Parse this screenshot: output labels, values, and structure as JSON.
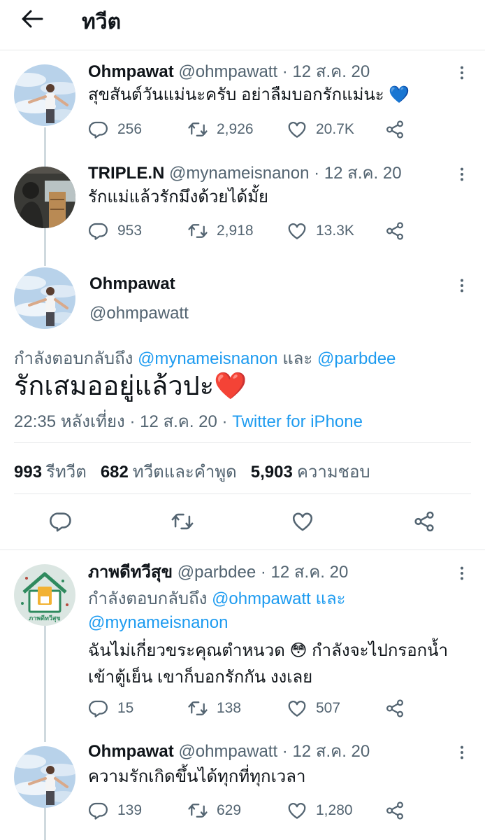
{
  "header": {
    "title": "ทวีต"
  },
  "tweets": [
    {
      "name": "Ohmpawat",
      "handle": "@ohmpawatt",
      "date": "· 12 ส.ค. 20",
      "text": "สุขสันต์วันแม่นะครับ อย่าลืมบอกรักแม่นะ 💙",
      "replies": "256",
      "retweets": "2,926",
      "likes": "20.7K"
    },
    {
      "name": "TRIPLE.N",
      "handle": "@mynameisnanon",
      "date": "· 12 ส.ค. 20",
      "text": "รักแม่แล้วรักมึงด้วยได้มั้ย",
      "replies": "953",
      "retweets": "2,918",
      "likes": "13.3K"
    }
  ],
  "main_tweet": {
    "name": "Ohmpawat",
    "handle": "@ohmpawatt",
    "replying_label": "กำลังตอบกลับถึง",
    "mention_1": "@mynameisnanon",
    "and_word": "และ",
    "mention_2": "@parbdee",
    "text": "รักเสมออยู่แล้วปะ❤️",
    "meta_time": "22:35 หลังเที่ยง · 12 ส.ค. 20 ·",
    "meta_source": "Twitter for iPhone",
    "stats": {
      "retweets_count": "993",
      "retweets_label": "รีทวีต",
      "quotes_count": "682",
      "quotes_label": "ทวีตและคำพูด",
      "likes_count": "5,903",
      "likes_label": "ความชอบ"
    }
  },
  "replies": [
    {
      "name": "ภาพดีทวีสุข",
      "handle": "@parbdee",
      "date": "· 12 ส.ค. 20",
      "replying_label": "กำลังตอบกลับถึง",
      "mention_1": "@ohmpawatt",
      "and_word": "และ",
      "mention_2": "@mynameisnanon",
      "text_line_1": "ฉันไม่เกี่ยวขระคุณตำหนวด 😳 กำลังจะไปกรอกน้ำ",
      "text_line_2": "เข้าตู้เย็น เขาก็บอกรักกัน งงเลย",
      "avatar_caption": "ภาพดีทวีสุข",
      "replies": "15",
      "retweets": "138",
      "likes": "507"
    },
    {
      "name": "Ohmpawat",
      "handle": "@ohmpawatt",
      "date": "· 12 ส.ค. 20",
      "text": "ความรักเกิดขึ้นได้ทุกที่ทุกเวลา",
      "replies": "139",
      "retweets": "629",
      "likes": "1,280"
    }
  ],
  "icons": {
    "back": "arrow-left-icon",
    "more": "more-vertical-icon",
    "reply": "reply-icon",
    "retweet": "retweet-icon",
    "like": "heart-icon",
    "share": "share-icon"
  },
  "colors": {
    "accent": "#1d9bf0",
    "muted": "#536471",
    "text": "#0f1419",
    "heart": "#e0245e"
  }
}
